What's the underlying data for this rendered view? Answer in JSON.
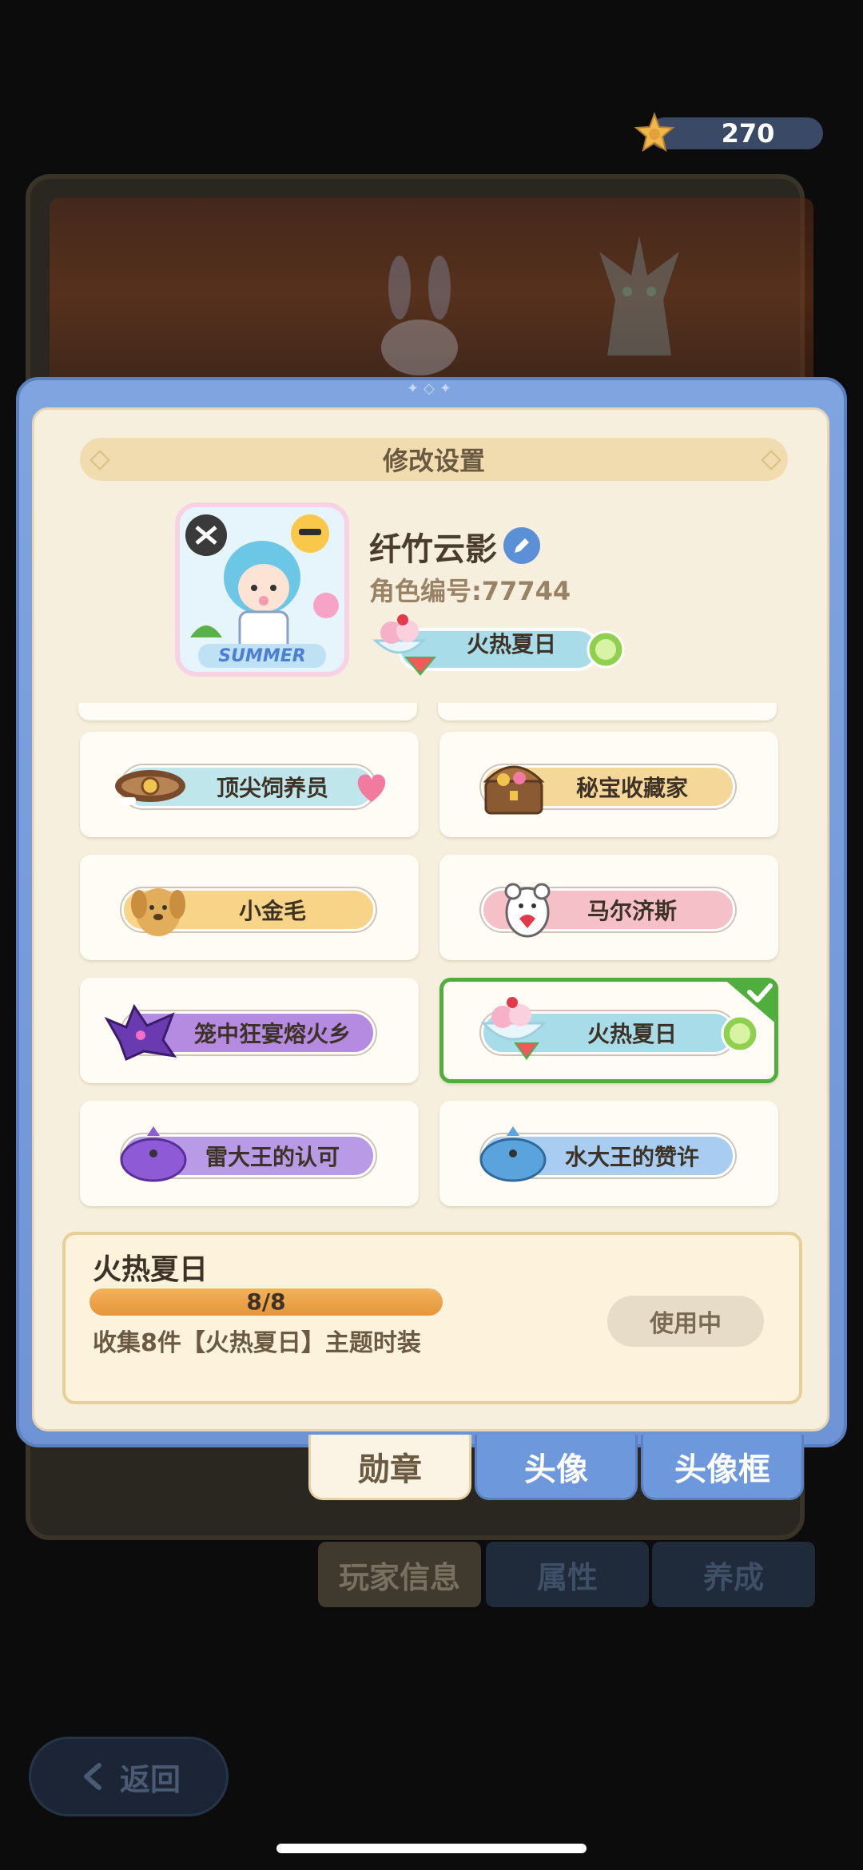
{
  "currency": {
    "amount": "270",
    "icon": "star-coin-icon"
  },
  "background_tabs": [
    "玩家信息",
    "属性",
    "养成"
  ],
  "back_button": {
    "label": "返回"
  },
  "dialog": {
    "title": "修改设置",
    "profile": {
      "name": "纤竹云影",
      "role_id": "角色编号:77744",
      "avatar_text": "SUMMER",
      "current_badge": "火热夏日"
    }
  },
  "badges": [
    {
      "label": "顶尖饲养员",
      "icon": "collar-icon",
      "color": "#bfe6ea",
      "selected": false
    },
    {
      "label": "秘宝收藏家",
      "icon": "treasure-chest-icon",
      "color": "#f5d79a",
      "selected": false
    },
    {
      "label": "小金毛",
      "icon": "golden-dog-icon",
      "color": "#f7d487",
      "selected": false
    },
    {
      "label": "马尔济斯",
      "icon": "white-dog-icon",
      "color": "#f5c0c8",
      "selected": false
    },
    {
      "label": "笼中狂宴熔火乡",
      "icon": "purple-dragon-icon",
      "color": "#b48be0",
      "selected": false
    },
    {
      "label": "火热夏日",
      "icon": "ice-cream-icon",
      "color": "#a7dce8",
      "selected": true
    },
    {
      "label": "雷大王的认可",
      "icon": "thunder-king-icon",
      "color": "#b99ae6",
      "selected": false
    },
    {
      "label": "水大王的赞许",
      "icon": "water-king-icon",
      "color": "#a9cdf0",
      "selected": false
    }
  ],
  "info": {
    "title": "火热夏日",
    "progress_text": "8/8",
    "progress": 1.0,
    "description": "收集8件【火热夏日】主题时装",
    "status_button": "使用中"
  },
  "tabs": [
    "勋章",
    "头像",
    "头像框"
  ]
}
